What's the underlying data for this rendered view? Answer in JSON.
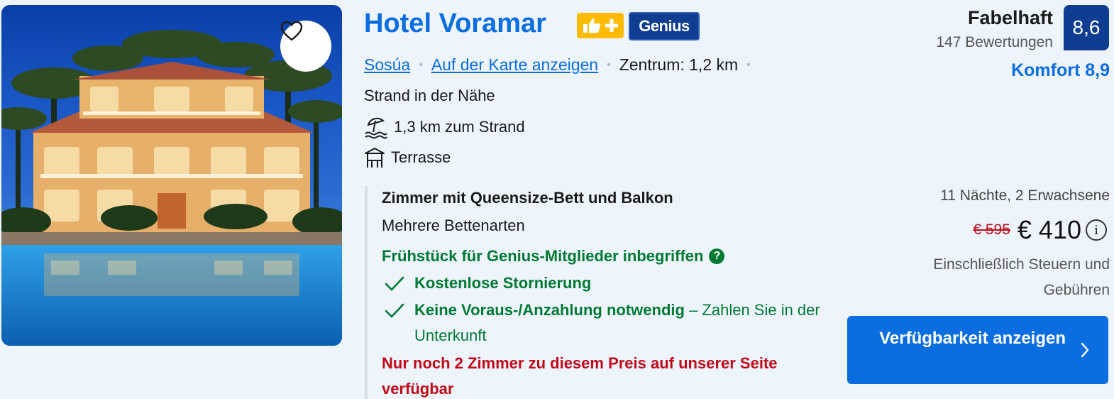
{
  "hotel": {
    "name": "Hotel Voramar",
    "genius_label": "Genius",
    "location_link": "Sosúa",
    "map_link": "Auf der Karte anzeigen",
    "distance_center": "Zentrum: 1,2 km",
    "beach_near": "Strand in der Nähe",
    "features": [
      {
        "icon": "beach-icon",
        "label": "1,3 km zum Strand"
      },
      {
        "icon": "terrace-icon",
        "label": "Terrasse"
      }
    ]
  },
  "rating": {
    "word": "Fabelhaft",
    "reviews": "147 Bewertungen",
    "score": "8,6",
    "comfort": "Komfort 8,9"
  },
  "room": {
    "title": "Zimmer mit Queensize-Bett und Balkon",
    "beds": "Mehrere Bettenarten",
    "breakfast": "Frühstück für Genius-Mitglieder inbegriffen",
    "free_cancel": "Kostenlose Stornierung",
    "no_prepay_bold": "Keine Voraus-/Anzahlung notwendig",
    "no_prepay_rest": "– Zahlen Sie in der Unterkunft",
    "scarcity": "Nur noch 2 Zimmer zu diesem Preis auf unserer Seite verfügbar"
  },
  "price": {
    "stay": "11 Nächte, 2 Erwachsene",
    "old": "€ 595",
    "new": "€ 410",
    "taxes": "Einschließlich Steuern und Gebühren"
  },
  "cta": {
    "label": "Verfügbarkeit anzeigen"
  },
  "colors": {
    "brand_blue": "#0a6de0",
    "dark_blue": "#0f3d91",
    "green": "#007a33",
    "red": "#c00a17",
    "yellow": "#febb02"
  }
}
